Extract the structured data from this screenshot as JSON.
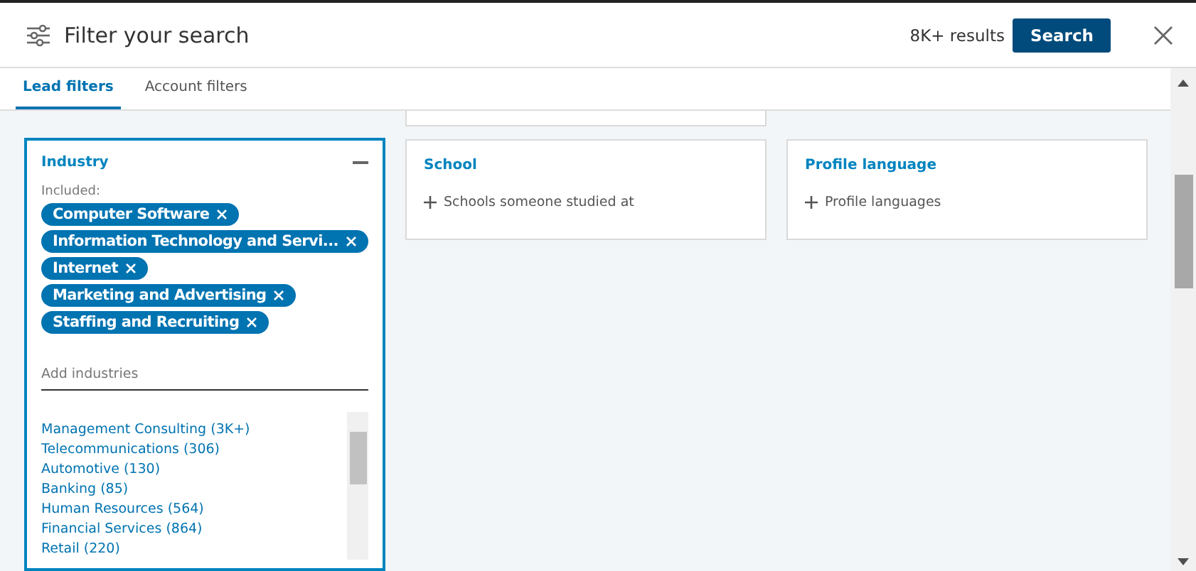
{
  "header": {
    "title": "Filter your search",
    "results": "8K+ results",
    "search_button": "Search"
  },
  "tabs": [
    {
      "label": "Lead filters",
      "selected": true
    },
    {
      "label": "Account filters",
      "selected": false
    }
  ],
  "filters": [
    {
      "kind": "expanded",
      "title": "Industry",
      "included_label": "Included:",
      "tags": [
        "Computer Software",
        "Information Technology and Servi...",
        "Internet",
        "Marketing and Advertising",
        "Staffing and Recruiting"
      ],
      "input": {
        "placeholder": "Add industries"
      },
      "suggestions": [
        "Management Consulting (3K+)",
        "Telecommunications (306)",
        "Automotive (130)",
        "Banking (85)",
        "Human Resources (564)",
        "Financial Services (864)",
        "Retail (220)"
      ]
    },
    {
      "kind": "collapsed",
      "title": "School",
      "add_label": "Schools someone studied at"
    },
    {
      "kind": "collapsed",
      "title": "Profile language",
      "add_label": "Profile languages"
    }
  ]
}
